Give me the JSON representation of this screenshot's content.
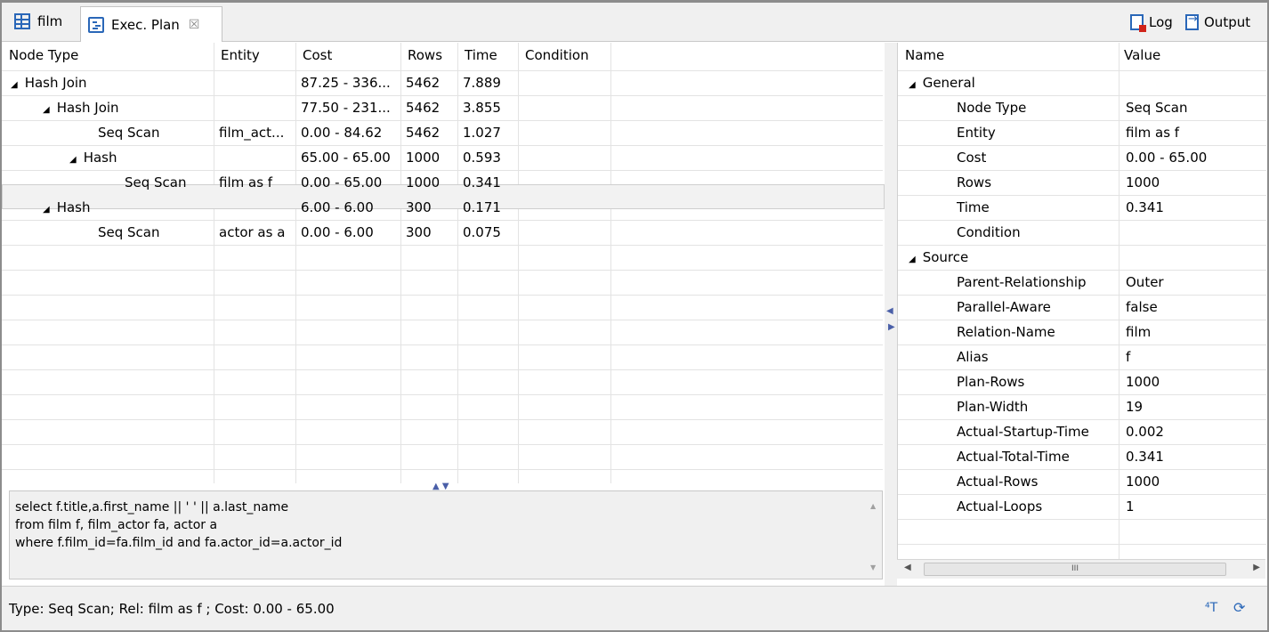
{
  "tabs": [
    {
      "label": "film"
    },
    {
      "label": "Exec. Plan",
      "close": "☒"
    }
  ],
  "toolbar": {
    "log_label": "Log",
    "output_label": "Output"
  },
  "plan_table": {
    "columns": [
      "Node Type",
      "Entity",
      "Cost",
      "Rows",
      "Time",
      "Condition"
    ],
    "rows": [
      {
        "node": "Hash Join",
        "expand": "◢",
        "entity": "",
        "cost": "87.25 - 336...",
        "rows": "5462",
        "time": "7.889",
        "condition": ""
      },
      {
        "node": "Hash Join",
        "expand": "◢",
        "entity": "",
        "cost": "77.50 - 231...",
        "rows": "5462",
        "time": "3.855",
        "condition": ""
      },
      {
        "node": "Seq Scan",
        "expand": "",
        "entity": "film_act...",
        "cost": "0.00 - 84.62",
        "rows": "5462",
        "time": "1.027",
        "condition": ""
      },
      {
        "node": "Hash",
        "expand": "◢",
        "entity": "",
        "cost": "65.00 - 65.00",
        "rows": "1000",
        "time": "0.593",
        "condition": ""
      },
      {
        "node": "Seq Scan",
        "expand": "",
        "entity": "film as f",
        "cost": "0.00 - 65.00",
        "rows": "1000",
        "time": "0.341",
        "condition": ""
      },
      {
        "node": "Hash",
        "expand": "◢",
        "entity": "",
        "cost": "6.00 - 6.00",
        "rows": "300",
        "time": "0.171",
        "condition": ""
      },
      {
        "node": "Seq Scan",
        "expand": "",
        "entity": "actor as a",
        "cost": "0.00 - 6.00",
        "rows": "300",
        "time": "0.075",
        "condition": ""
      }
    ]
  },
  "sql": {
    "lines": [
      "select f.title,a.first_name || ' ' || a.last_name",
      "from film f, film_actor fa, actor a",
      "where f.film_id=fa.film_id and fa.actor_id=a.actor_id"
    ]
  },
  "properties": {
    "columns": [
      "Name",
      "Value"
    ],
    "rows": [
      {
        "name": "General",
        "value": "",
        "group": true,
        "expand": "◢"
      },
      {
        "name": "Node Type",
        "value": "Seq Scan"
      },
      {
        "name": "Entity",
        "value": "film as f"
      },
      {
        "name": "Cost",
        "value": "0.00 - 65.00"
      },
      {
        "name": "Rows",
        "value": "1000"
      },
      {
        "name": "Time",
        "value": "0.341"
      },
      {
        "name": "Condition",
        "value": ""
      },
      {
        "name": "Source",
        "value": "",
        "group": true,
        "expand": "◢"
      },
      {
        "name": "Parent-Relationship",
        "value": "Outer"
      },
      {
        "name": "Parallel-Aware",
        "value": "false"
      },
      {
        "name": "Relation-Name",
        "value": "film"
      },
      {
        "name": "Alias",
        "value": "f"
      },
      {
        "name": "Plan-Rows",
        "value": "1000"
      },
      {
        "name": "Plan-Width",
        "value": "19"
      },
      {
        "name": "Actual-Startup-Time",
        "value": "0.002"
      },
      {
        "name": "Actual-Total-Time",
        "value": "0.341"
      },
      {
        "name": "Actual-Rows",
        "value": "1000"
      },
      {
        "name": "Actual-Loops",
        "value": "1"
      }
    ],
    "scroll_thumb": "III"
  },
  "status": {
    "text": "Type: Seq Scan; Rel: film as f ; Cost: 0.00 - 65.00"
  },
  "icons": {
    "status_icon_1": "format-icon",
    "status_icon_2": "sync-icon"
  },
  "colors": {
    "accent": "#2a67b8",
    "selection": "#f2f2f2"
  }
}
